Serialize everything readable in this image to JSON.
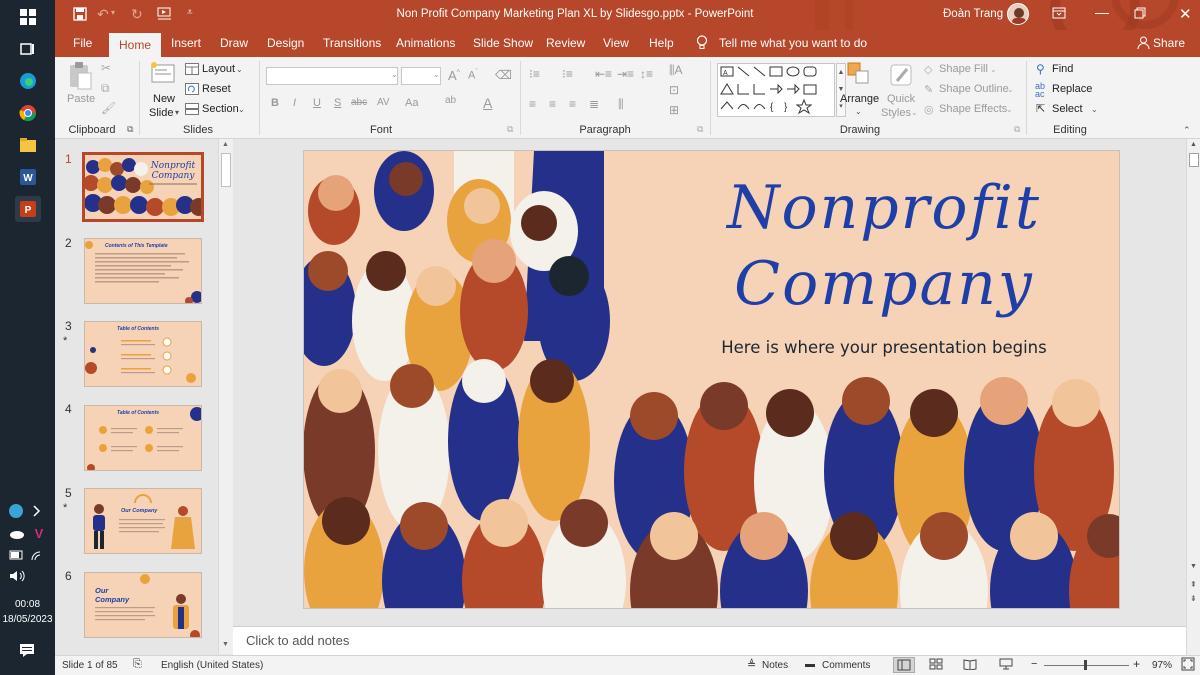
{
  "taskbar": {
    "time": "00:08",
    "date": "18/05/2023"
  },
  "titlebar": {
    "title": "Non Profit Company Marketing Plan XL by Slidesgo.pptx  -  PowerPoint",
    "user": "Đoàn Trang"
  },
  "tabs": [
    "File",
    "Home",
    "Insert",
    "Draw",
    "Design",
    "Transitions",
    "Animations",
    "Slide Show",
    "Review",
    "View",
    "Help"
  ],
  "tell_me": "Tell me what you want to do",
  "share": "Share",
  "ribbon": {
    "clipboard": {
      "label": "Clipboard",
      "paste": "Paste"
    },
    "slides": {
      "label": "Slides",
      "new_slide_1": "New",
      "new_slide_2": "Slide",
      "layout": "Layout",
      "reset": "Reset",
      "section": "Section"
    },
    "font": {
      "label": "Font"
    },
    "paragraph": {
      "label": "Paragraph"
    },
    "drawing": {
      "label": "Drawing",
      "arrange": "Arrange",
      "quick_styles_1": "Quick",
      "quick_styles_2": "Styles",
      "shape_fill": "Shape Fill",
      "shape_outline": "Shape Outline",
      "shape_effects": "Shape Effects"
    },
    "editing": {
      "label": "Editing",
      "find": "Find",
      "replace": "Replace",
      "select": "Select"
    }
  },
  "thumbnails": [
    {
      "num": "1",
      "title_1": "Nonprofit",
      "title_2": "Company",
      "star": ""
    },
    {
      "num": "2",
      "title": "Contents of This Template",
      "star": ""
    },
    {
      "num": "3",
      "title": "Table of Contents",
      "star": "*"
    },
    {
      "num": "4",
      "title": "Table of Contents",
      "star": ""
    },
    {
      "num": "5",
      "title": "Our Company",
      "star": "*"
    },
    {
      "num": "6",
      "title_1": "Our",
      "title_2": "Company",
      "star": ""
    }
  ],
  "slide": {
    "title_line1": "Nonprofit",
    "title_line2": "Company",
    "subtitle": "Here is where your presentation begins"
  },
  "notes_placeholder": "Click to add notes",
  "status": {
    "slide_of": "Slide 1 of 85",
    "language": "English (United States)",
    "notes": "Notes",
    "comments": "Comments",
    "zoom": "97%"
  },
  "colors": {
    "accent": "#b7472a",
    "slide_bg": "#f6d2b7",
    "title_blue": "#1f3fa8"
  }
}
